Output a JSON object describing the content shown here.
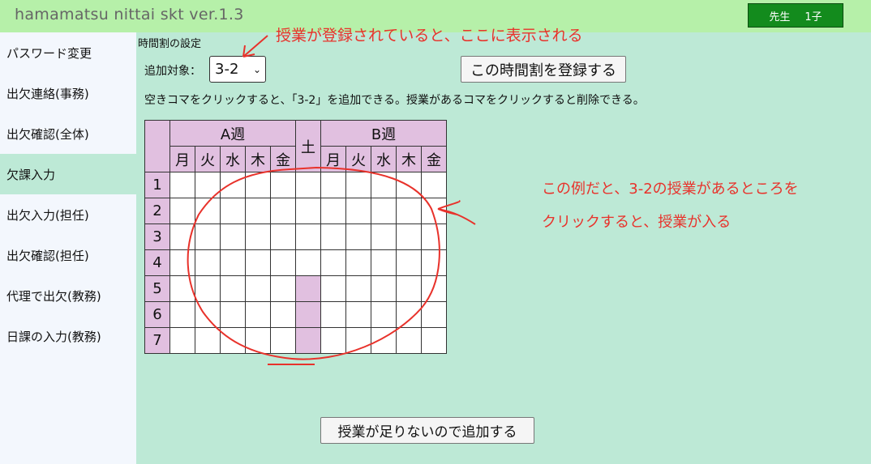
{
  "header": {
    "app_title": "hamamatsu nittai skt ver.1.3",
    "user_role": "先生",
    "user_name": "1子"
  },
  "sidebar": {
    "items": [
      {
        "label": "パスワード変更",
        "active": false
      },
      {
        "label": "出欠連絡(事務)",
        "active": false
      },
      {
        "label": "出欠確認(全体)",
        "active": false
      },
      {
        "label": "欠課入力",
        "active": true
      },
      {
        "label": "出欠入力(担任)",
        "active": false
      },
      {
        "label": "出欠確認(担任)",
        "active": false
      },
      {
        "label": "代理で出欠(教務)",
        "active": false
      },
      {
        "label": "日課の入力(教務)",
        "active": false
      }
    ]
  },
  "main": {
    "section_title": "時間割の設定",
    "target_label": "追加対象：",
    "target_value": "3-2",
    "register_button": "この時間割を登録する",
    "instruction": "空きコマをクリックすると、「3-2」を追加できる。授業があるコマをクリックすると削除できる。",
    "add_lesson_button": "授業が足りないので追加する"
  },
  "timetable": {
    "week_a": "A週",
    "week_b": "B週",
    "saturday": "土",
    "days": [
      "月",
      "火",
      "水",
      "木",
      "金"
    ],
    "periods": [
      "1",
      "2",
      "3",
      "4",
      "5",
      "6",
      "7"
    ],
    "saturday_shaded_periods": [
      "5",
      "6",
      "7"
    ]
  },
  "annotations": {
    "top": "授業が登録されていると、ここに表示される",
    "right_line1": "この例だと、3-2の授業があるところを",
    "right_line2": "クリックすると、授業が入る"
  },
  "colors": {
    "topbar": "#b6f0a9",
    "main_bg": "#bde9d6",
    "sidebar_bg": "#f3f7fd",
    "user_box": "#138b1d",
    "header_cell": "#e1c0e0",
    "annotation": "#e8322b"
  }
}
